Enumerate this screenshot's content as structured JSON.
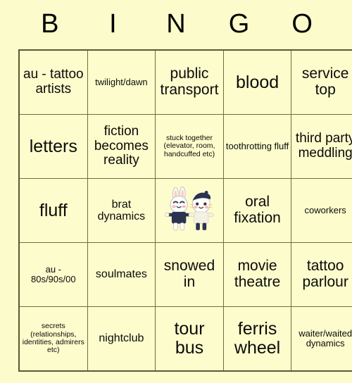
{
  "header": {
    "letters": [
      "B",
      "I",
      "N",
      "G",
      "O"
    ]
  },
  "grid": {
    "rows": [
      [
        {
          "text": "au - tattoo artists",
          "size": "fs-lg"
        },
        {
          "text": "twilight/dawn",
          "size": "fs-sm"
        },
        {
          "text": "public transport",
          "size": "fs-xl"
        },
        {
          "text": "blood",
          "size": "fs-xxl"
        },
        {
          "text": "service top",
          "size": "fs-xl"
        }
      ],
      [
        {
          "text": "letters",
          "size": "fs-xxl"
        },
        {
          "text": "fiction becomes reality",
          "size": "fs-lg"
        },
        {
          "text": "stuck together (elevator, room, handcuffed etc)",
          "size": "fs-xs"
        },
        {
          "text": "toothrotting fluff",
          "size": "fs-sm"
        },
        {
          "text": "third party meddling",
          "size": "fs-lg"
        }
      ],
      [
        {
          "text": "fluff",
          "size": "fs-xxl"
        },
        {
          "text": "brat dynamics",
          "size": "fs-md"
        },
        {
          "text": "",
          "size": "free",
          "free_space": true,
          "art": "two-bunny-characters-holding-hands"
        },
        {
          "text": "oral fixation",
          "size": "fs-xl"
        },
        {
          "text": "coworkers",
          "size": "fs-sm"
        }
      ],
      [
        {
          "text": "au - 80s/90s/00",
          "size": "fs-sm"
        },
        {
          "text": "soulmates",
          "size": "fs-md"
        },
        {
          "text": "snowed in",
          "size": "fs-xl"
        },
        {
          "text": "movie theatre",
          "size": "fs-xl"
        },
        {
          "text": "tattoo parlour",
          "size": "fs-xl"
        }
      ],
      [
        {
          "text": "secrets (relationships, identities, admirers etc)",
          "size": "fs-xs"
        },
        {
          "text": "nightclub",
          "size": "fs-md"
        },
        {
          "text": "tour bus",
          "size": "fs-xxl"
        },
        {
          "text": "ferris wheel",
          "size": "fs-xxl"
        },
        {
          "text": "waiter/waited dynamics",
          "size": "fs-sm"
        }
      ]
    ]
  },
  "colors": {
    "page_background": "#fbfbcb",
    "cell_background": "#fcfccc",
    "grid_border": "#5a5a32",
    "cell_border": "#6e6e40",
    "text": "#0b0b0b"
  }
}
